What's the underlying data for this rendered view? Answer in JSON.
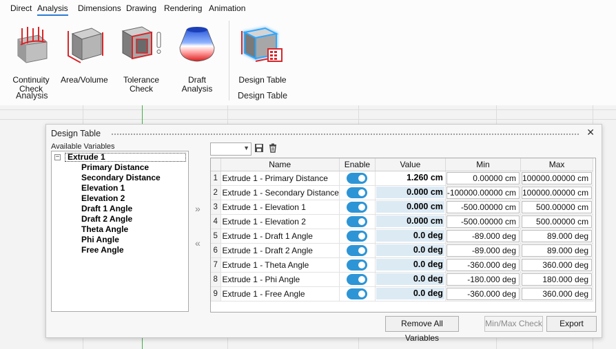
{
  "ribbon": {
    "tabs": [
      "Direct",
      "Analysis",
      "Dimensions",
      "Drawing",
      "Rendering",
      "Animation"
    ],
    "active_tab": "Analysis",
    "analysis_group": {
      "label": "Analysis",
      "buttons": [
        "Continuity Check",
        "Area/Volume",
        "Tolerance Check",
        "Draft Analysis"
      ]
    },
    "design_group": {
      "label": "Design Table",
      "buttons": [
        "Design Table"
      ]
    }
  },
  "dialog": {
    "title": "Design Table",
    "close_glyph": "✕",
    "available_label": "Available Variables",
    "tree": {
      "root": "Extrude 1",
      "expander": "−",
      "items": [
        "Primary Distance",
        "Secondary Distance",
        "Elevation 1",
        "Elevation 2",
        "Draft 1 Angle",
        "Draft 2 Angle",
        "Theta Angle",
        "Phi Angle",
        "Free Angle"
      ]
    },
    "add_arrow": "»",
    "remove_arrow": "«",
    "combo_value": "",
    "grid": {
      "columns": [
        "Name",
        "Enable",
        "Value",
        "Min",
        "Max"
      ],
      "rows": [
        {
          "num": "1",
          "name": "Extrude 1 - Primary Distance",
          "enabled": true,
          "value": "1.260 cm",
          "min": "0.00000 cm",
          "max": "100000.00000 cm"
        },
        {
          "num": "2",
          "name": "Extrude 1 - Secondary Distance",
          "enabled": true,
          "value": "0.000 cm",
          "min": "-100000.00000 cm",
          "max": "100000.00000 cm"
        },
        {
          "num": "3",
          "name": "Extrude 1 - Elevation 1",
          "enabled": true,
          "value": "0.000 cm",
          "min": "-500.00000 cm",
          "max": "500.00000 cm"
        },
        {
          "num": "4",
          "name": "Extrude 1 - Elevation 2",
          "enabled": true,
          "value": "0.000 cm",
          "min": "-500.00000 cm",
          "max": "500.00000 cm"
        },
        {
          "num": "5",
          "name": "Extrude 1 - Draft 1 Angle",
          "enabled": true,
          "value": "0.0 deg",
          "min": "-89.000 deg",
          "max": "89.000 deg"
        },
        {
          "num": "6",
          "name": "Extrude 1 - Draft 2 Angle",
          "enabled": true,
          "value": "0.0 deg",
          "min": "-89.000 deg",
          "max": "89.000 deg"
        },
        {
          "num": "7",
          "name": "Extrude 1 - Theta Angle",
          "enabled": true,
          "value": "0.0 deg",
          "min": "-360.000 deg",
          "max": "360.000 deg"
        },
        {
          "num": "8",
          "name": "Extrude 1 - Phi Angle",
          "enabled": true,
          "value": "0.0 deg",
          "min": "-180.000 deg",
          "max": "180.000 deg"
        },
        {
          "num": "9",
          "name": "Extrude 1 - Free Angle",
          "enabled": true,
          "value": "0.0 deg",
          "min": "-360.000 deg",
          "max": "360.000 deg"
        }
      ]
    },
    "buttons": {
      "remove_all": "Remove All Variables",
      "minmax_check": "Min/Max Check",
      "export": "Export"
    }
  },
  "colors": {
    "accent": "#2b7bd2",
    "toggle_on": "#2d95d6",
    "value_cell": "#dceaf4",
    "axis_green": "#3cb043"
  },
  "icons": [
    "continuity-check-icon",
    "area-volume-icon",
    "tolerance-check-icon",
    "draft-analysis-icon",
    "design-table-icon",
    "save-icon",
    "delete-icon"
  ]
}
